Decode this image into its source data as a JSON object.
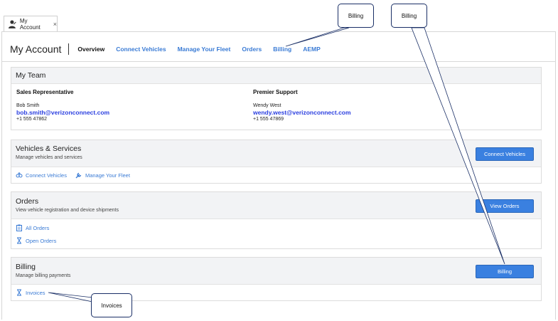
{
  "tab": {
    "label": "My Account",
    "close": "×"
  },
  "header": {
    "title": "My Account",
    "nav": [
      {
        "label": "Overview",
        "active": true
      },
      {
        "label": "Connect Vehicles"
      },
      {
        "label": "Manage Your Fleet"
      },
      {
        "label": "Orders"
      },
      {
        "label": "Billing"
      },
      {
        "label": "AEMP"
      }
    ]
  },
  "team": {
    "title": "My Team",
    "sales": {
      "heading": "Sales Representative",
      "name": "Bob Smith",
      "email": "bob.smith@verizonconnect.com",
      "phone": "+1 555 47862"
    },
    "support": {
      "heading": "Premier Support",
      "name": "Wendy West",
      "email": "wendy.west@verizonconnect.com",
      "phone": "+1 555 47869"
    }
  },
  "vehicles": {
    "title": "Vehicles & Services",
    "subtitle": "Manage vehicles and services",
    "button": "Connect Vehicles",
    "links": [
      "Connect Vehicles",
      "Manage Your Fleet"
    ]
  },
  "orders": {
    "title": "Orders",
    "subtitle": "View vehicle registration and device shipments",
    "button": "View Orders",
    "links": [
      "All Orders",
      "Open Orders"
    ]
  },
  "billing": {
    "title": "Billing",
    "subtitle": "Manage billing payments",
    "button": "Billing",
    "links": [
      "Invoices"
    ]
  },
  "callouts": {
    "billing_nav": "Billing",
    "billing_button": "Billing",
    "invoices": "Invoices"
  },
  "colors": {
    "accent": "#3a80e0",
    "link": "#3a7bd5",
    "email": "#2b3fe0",
    "callout_border": "#1a2f66"
  },
  "icons": {
    "tab": "user-icon",
    "connect": "link-vehicle-icon",
    "fleet": "wrench-icon",
    "all_orders": "clipboard-icon",
    "open_orders": "hourglass-icon",
    "invoices": "hourglass-icon"
  }
}
